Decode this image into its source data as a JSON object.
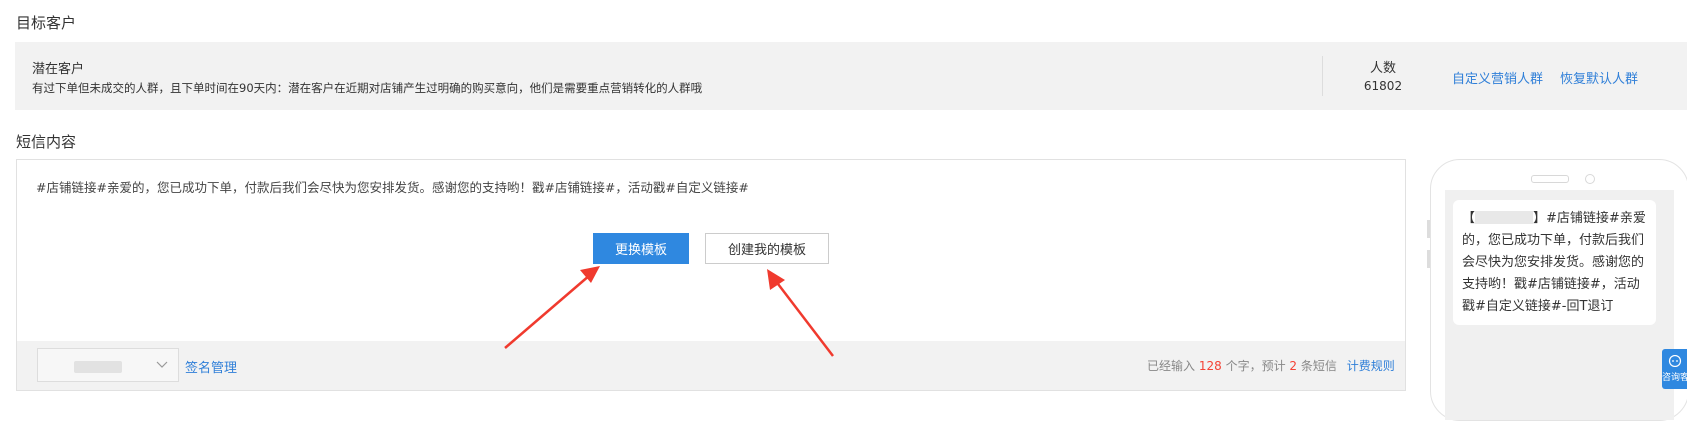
{
  "target_section": {
    "title": "目标客户",
    "audience_name": "潜在客户",
    "audience_desc": "有过下单但未成交的人群，且下单时间在90天内：潜在客户在近期对店铺产生过明确的购买意向，他们是需要重点营销转化的人群哦",
    "count_label": "人数",
    "count_value": "61802",
    "link_custom": "自定义营销人群",
    "link_reset": "恢复默认人群"
  },
  "sms_section": {
    "title": "短信内容",
    "message": "#店铺链接#亲爱的，您已成功下单，付款后我们会尽快为您安排发货。感谢您的支持哟！戳#店铺链接#，活动戳#自定义链接#",
    "btn_change_template": "更换模板",
    "btn_create_template": "创建我的模板",
    "signature_link": "签名管理",
    "counter": {
      "prefix": "已经输入",
      "chars": "128",
      "mid": "个字，预计",
      "count": "2",
      "suffix": "条短信",
      "billing_link": "计费规则"
    }
  },
  "preview": {
    "open_bracket": "【",
    "close_bracket": "】",
    "text": "#店铺链接#亲爱的，您已成功下单，付款后我们会尽快为您安排发货。感谢您的支持哟！戳#店铺链接#，活动戳#自定义链接#-回T退订"
  },
  "chat_widget": {
    "label": "咨询客服"
  },
  "colors": {
    "accent": "#2f88e0",
    "link": "#2f7fd8",
    "highlight": "#f44336",
    "annotation_arrow": "#f03a2e"
  }
}
